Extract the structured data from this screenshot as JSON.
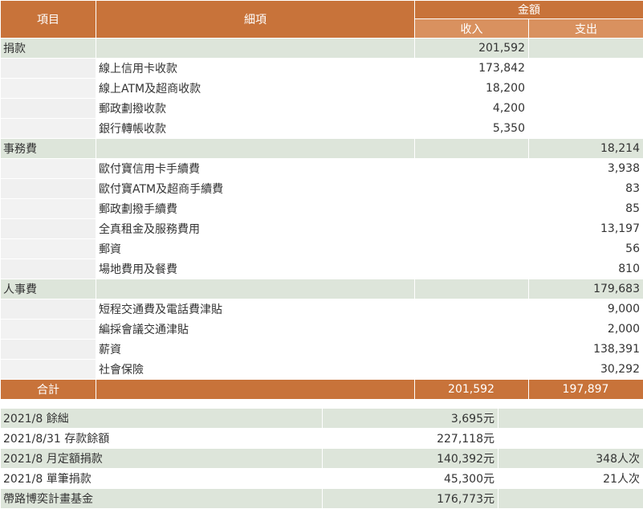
{
  "header": {
    "col_item": "項目",
    "col_detail": "細項",
    "col_amount": "金額",
    "col_income": "收入",
    "col_expense": "支出"
  },
  "rows": [
    {
      "type": "cat",
      "item": "捐款",
      "detail": "",
      "income": "201,592",
      "expense": ""
    },
    {
      "type": "item",
      "item": "",
      "detail": "線上信用卡收款",
      "income": "173,842",
      "expense": ""
    },
    {
      "type": "item",
      "item": "",
      "detail": "線上ATM及超商收款",
      "income": "18,200",
      "expense": ""
    },
    {
      "type": "item",
      "item": "",
      "detail": "郵政劃撥收款",
      "income": "4,200",
      "expense": ""
    },
    {
      "type": "item",
      "item": "",
      "detail": "銀行轉帳收款",
      "income": "5,350",
      "expense": ""
    },
    {
      "type": "cat",
      "item": "事務費",
      "detail": "",
      "income": "",
      "expense": "18,214"
    },
    {
      "type": "item",
      "item": "",
      "detail": "歐付寶信用卡手續費",
      "income": "",
      "expense": "3,938"
    },
    {
      "type": "item",
      "item": "",
      "detail": "歐付寶ATM及超商手續費",
      "income": "",
      "expense": "83"
    },
    {
      "type": "item",
      "item": "",
      "detail": "郵政劃撥手續費",
      "income": "",
      "expense": "85"
    },
    {
      "type": "item",
      "item": "",
      "detail": "全真租金及服務費用",
      "income": "",
      "expense": "13,197"
    },
    {
      "type": "item",
      "item": "",
      "detail": "郵資",
      "income": "",
      "expense": "56"
    },
    {
      "type": "item",
      "item": "",
      "detail": "場地費用及餐費",
      "income": "",
      "expense": "810"
    },
    {
      "type": "cat",
      "item": "人事費",
      "detail": "",
      "income": "",
      "expense": "179,683"
    },
    {
      "type": "item",
      "item": "",
      "detail": "短程交通費及電話費津貼",
      "income": "",
      "expense": "9,000"
    },
    {
      "type": "item",
      "item": "",
      "detail": "編採會議交通津貼",
      "income": "",
      "expense": "2,000"
    },
    {
      "type": "item",
      "item": "",
      "detail": "薪資",
      "income": "",
      "expense": "138,391"
    },
    {
      "type": "item",
      "item": "",
      "detail": "社會保險",
      "income": "",
      "expense": "30,292"
    }
  ],
  "total": {
    "label": "合計",
    "income": "201,592",
    "expense": "197,897"
  },
  "summary": [
    {
      "label": "2021/8 餘絀",
      "value": "3,695元",
      "extra": ""
    },
    {
      "label": "2021/8/31 存款餘額",
      "value": "227,118元",
      "extra": ""
    },
    {
      "label": "2021/8 月定額捐款",
      "value": "140,392元",
      "extra": "348人次"
    },
    {
      "label": "2021/8 單筆捐款",
      "value": "45,300元",
      "extra": "21人次"
    },
    {
      "label": "帶路博奕計畫基金",
      "value": "176,773元",
      "extra": ""
    }
  ]
}
